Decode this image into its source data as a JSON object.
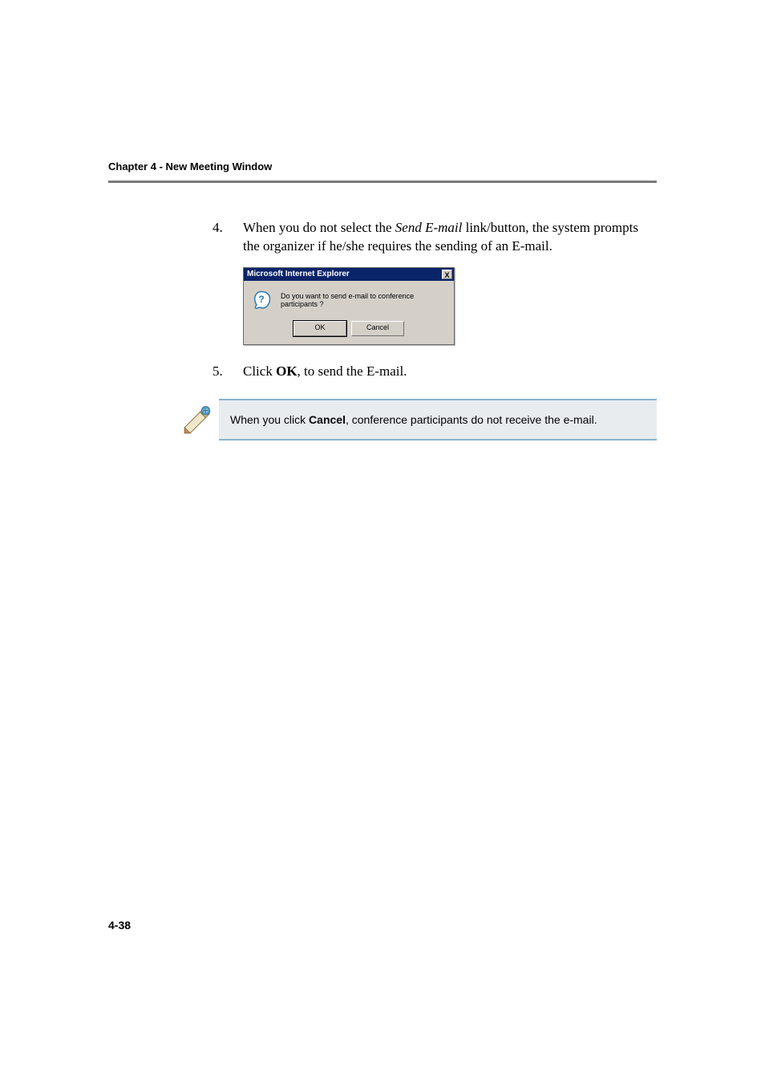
{
  "header": {
    "chapter": "Chapter 4 - New Meeting Window"
  },
  "steps": {
    "step4": {
      "num": "4.",
      "before_italic": "When you do not select the ",
      "italic": "Send E-mail",
      "after_italic": " link/button, the system prompts the organizer if he/she requires the sending of an E-mail."
    },
    "step5": {
      "num": "5.",
      "before_bold": "Click ",
      "bold": "OK",
      "after_bold": ", to send the E-mail."
    }
  },
  "dialog": {
    "title": "Microsoft Internet Explorer",
    "close_label": "X",
    "message": "Do you want to send e-mail to conference participants ?",
    "ok_label": "OK",
    "cancel_label": "Cancel"
  },
  "note": {
    "before_bold": "When you click ",
    "bold": "Cancel",
    "after_bold": ", conference participants do not receive the e-mail."
  },
  "footer": {
    "page": "4-38"
  }
}
